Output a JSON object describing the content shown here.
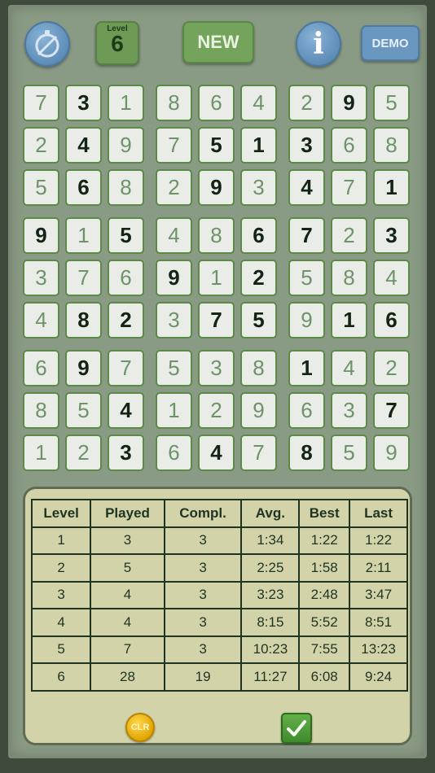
{
  "toolbar": {
    "level_label": "Level",
    "level_value": "6",
    "new_label": "NEW",
    "info_label": "i",
    "demo_label": "DEMO"
  },
  "grid": {
    "cells": [
      [
        "7",
        "3",
        "1",
        "8",
        "6",
        "4",
        "2",
        "9",
        "5"
      ],
      [
        "2",
        "4",
        "9",
        "7",
        "5",
        "1",
        "3",
        "6",
        "8"
      ],
      [
        "5",
        "6",
        "8",
        "2",
        "9",
        "3",
        "4",
        "7",
        "1"
      ],
      [
        "9",
        "1",
        "5",
        "4",
        "8",
        "6",
        "7",
        "2",
        "3"
      ],
      [
        "3",
        "7",
        "6",
        "9",
        "1",
        "2",
        "5",
        "8",
        "4"
      ],
      [
        "4",
        "8",
        "2",
        "3",
        "7",
        "5",
        "9",
        "1",
        "6"
      ],
      [
        "6",
        "9",
        "7",
        "5",
        "3",
        "8",
        "1",
        "4",
        "2"
      ],
      [
        "8",
        "5",
        "4",
        "1",
        "2",
        "9",
        "6",
        "3",
        "7"
      ],
      [
        "1",
        "2",
        "3",
        "6",
        "4",
        "7",
        "8",
        "5",
        "9"
      ]
    ],
    "given": [
      [
        0,
        1,
        0,
        0,
        0,
        0,
        0,
        1,
        0
      ],
      [
        0,
        1,
        0,
        0,
        1,
        1,
        1,
        0,
        0
      ],
      [
        0,
        1,
        0,
        0,
        1,
        0,
        1,
        0,
        1
      ],
      [
        1,
        0,
        1,
        0,
        0,
        1,
        1,
        0,
        1
      ],
      [
        0,
        0,
        0,
        1,
        0,
        1,
        0,
        0,
        0
      ],
      [
        0,
        1,
        1,
        0,
        1,
        1,
        0,
        1,
        1
      ],
      [
        0,
        1,
        0,
        0,
        0,
        0,
        1,
        0,
        0
      ],
      [
        0,
        0,
        1,
        0,
        0,
        0,
        0,
        0,
        1
      ],
      [
        0,
        0,
        1,
        0,
        1,
        0,
        1,
        0,
        0
      ]
    ]
  },
  "stats": {
    "headers": [
      "Level",
      "Played",
      "Compl.",
      "Avg.",
      "Best",
      "Last"
    ],
    "rows": [
      [
        "1",
        "3",
        "3",
        "1:34",
        "1:22",
        "1:22"
      ],
      [
        "2",
        "5",
        "3",
        "2:25",
        "1:58",
        "2:11"
      ],
      [
        "3",
        "4",
        "3",
        "3:23",
        "2:48",
        "3:47"
      ],
      [
        "4",
        "4",
        "3",
        "8:15",
        "5:52",
        "8:51"
      ],
      [
        "5",
        "7",
        "3",
        "10:23",
        "7:55",
        "13:23"
      ],
      [
        "6",
        "28",
        "19",
        "11:27",
        "6:08",
        "9:24"
      ]
    ],
    "clr_label": "CLR"
  },
  "icons": {
    "timer": "stopwatch-off-icon",
    "ok": "checkmark-icon"
  },
  "colors": {
    "background": "#8a9b85",
    "given_digit": "#142414",
    "filled_digit": "#6e9269",
    "cell_border": "#5a8a45",
    "panel": "#d3d3a9"
  }
}
